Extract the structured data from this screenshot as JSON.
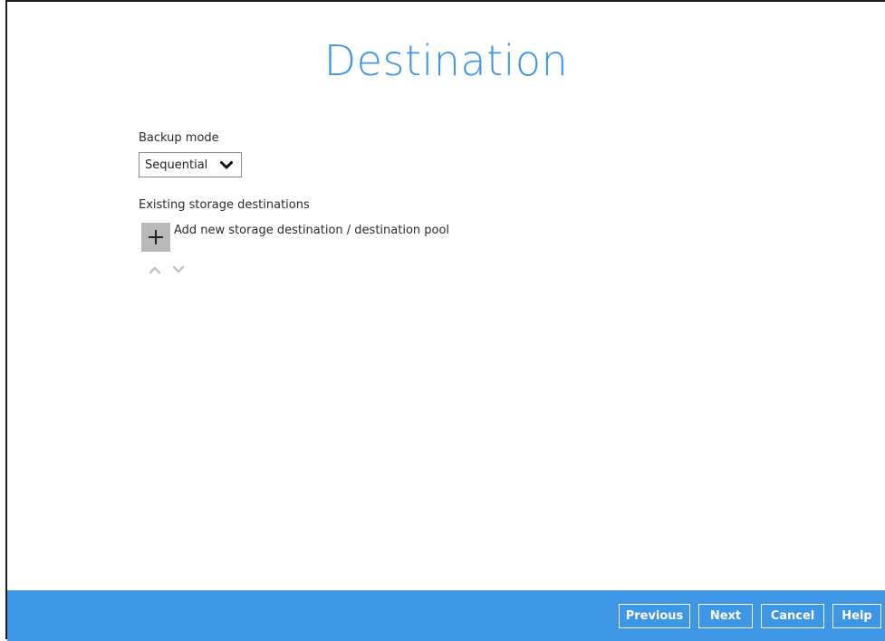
{
  "page": {
    "title": "Destination"
  },
  "backup_mode": {
    "label": "Backup mode",
    "selected": "Sequential"
  },
  "storage": {
    "section_label": "Existing storage destinations",
    "add_label": "Add new storage destination / destination pool"
  },
  "footer": {
    "previous_label": "Previous",
    "next_label": "Next",
    "cancel_label": "Cancel",
    "help_label": "Help"
  },
  "colors": {
    "accent": "#3d97e4",
    "add_button_bg": "#b9b9b9"
  },
  "icons": {
    "add": "plus-icon",
    "dropdown": "chevron-down-icon",
    "move_up": "chevron-up-icon",
    "move_down": "chevron-down-icon"
  }
}
